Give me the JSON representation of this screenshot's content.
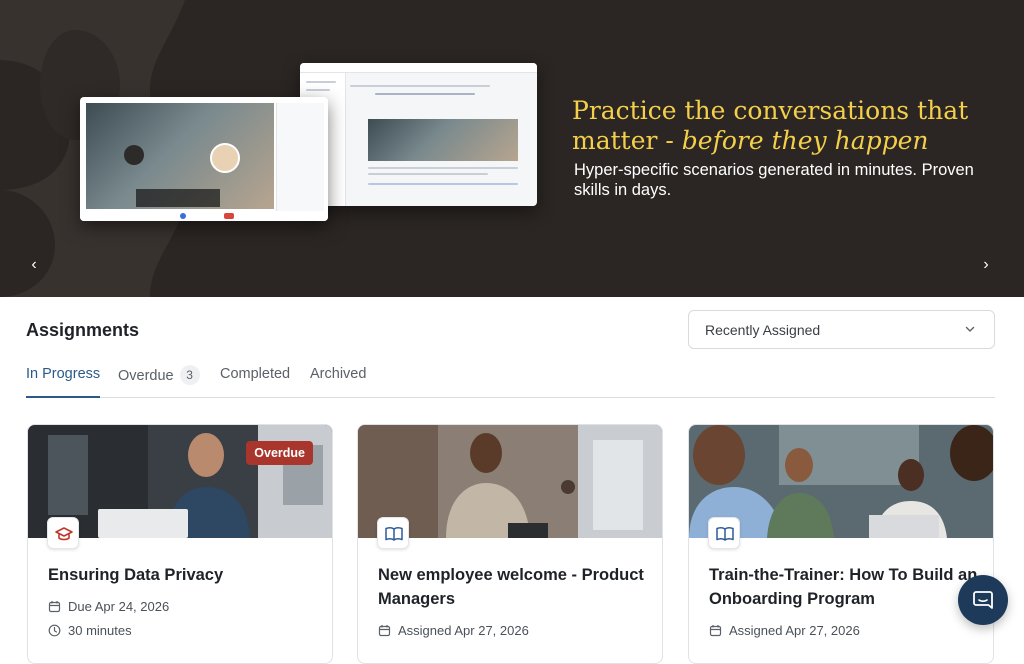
{
  "hero": {
    "title_part1": "Practice the conversations that matter - ",
    "title_emphasis": "before they happen",
    "subtitle": "Hyper-specific scenarios generated in minutes. Proven skills in days.",
    "prev_arrow": "‹",
    "next_arrow": "›",
    "accent_color": "#f4cf4a",
    "background_color": "#2b2624"
  },
  "assignments": {
    "title": "Assignments",
    "sort": {
      "selected": "Recently Assigned"
    },
    "tabs": [
      {
        "label": "In Progress",
        "active": true
      },
      {
        "label": "Overdue",
        "count": "3"
      },
      {
        "label": "Completed"
      },
      {
        "label": "Archived"
      }
    ],
    "cards": [
      {
        "title": "Ensuring Data Privacy",
        "badge": "Overdue",
        "icon": "graduation-cap-icon",
        "meta": [
          {
            "icon": "calendar-icon",
            "text": "Due Apr 24, 2026"
          },
          {
            "icon": "clock-icon",
            "text": "30 minutes"
          }
        ]
      },
      {
        "title": "New employee welcome - Product Managers",
        "icon": "book-icon",
        "meta": [
          {
            "icon": "calendar-icon",
            "text": "Assigned Apr 27, 2026"
          }
        ]
      },
      {
        "title": "Train-the-Trainer: How To Build an Onboarding Program",
        "icon": "book-icon",
        "meta": [
          {
            "icon": "calendar-icon",
            "text": "Assigned Apr 27, 2026"
          }
        ]
      }
    ]
  },
  "chat": {
    "icon": "chat-icon"
  }
}
